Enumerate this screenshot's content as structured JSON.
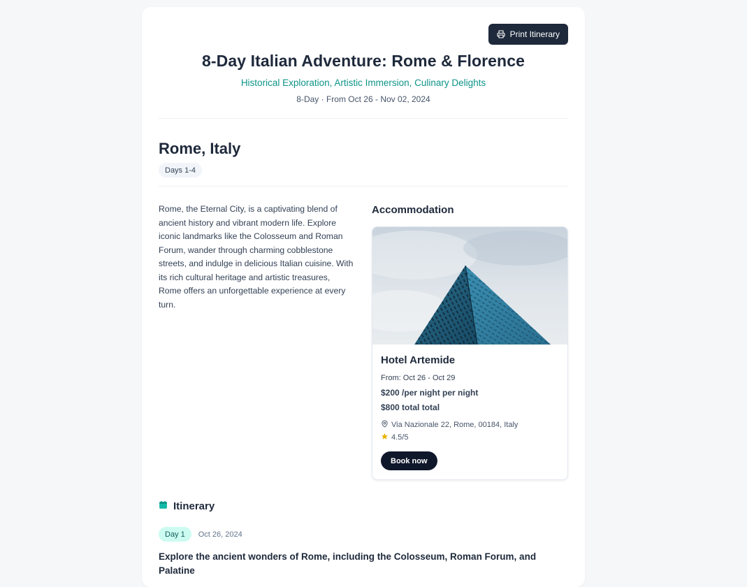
{
  "header": {
    "print_label": "Print Itinerary",
    "title": "8-Day Italian Adventure: Rome & Florence",
    "subtitle": "Historical Exploration, Artistic Immersion, Culinary Delights",
    "dates": "8-Day · From Oct 26 - Nov 02, 2024"
  },
  "destination": {
    "city": "Rome, Italy",
    "days_badge": "Days 1-4",
    "description": "Rome, the Eternal City, is a captivating blend of ancient history and vibrant modern life. Explore iconic landmarks like the Colosseum and Roman Forum, wander through charming cobblestone streets, and indulge in delicious Italian cuisine. With its rich cultural heritage and artistic treasures, Rome offers an unforgettable experience at every turn."
  },
  "accommodation": {
    "heading": "Accommodation",
    "hotel_name": "Hotel Artemide",
    "stay": "From: Oct 26 - Oct 29",
    "nightly_price": "$200 /per night per night",
    "total_price": "$800 total total",
    "address": "Via Nazionale 22, Rome, 00184, Italy",
    "rating": "4.5/5",
    "book_label": "Book now"
  },
  "itinerary": {
    "heading": "Itinerary",
    "days": [
      {
        "badge": "Day 1",
        "date": "Oct 26, 2024",
        "description": "Explore the ancient wonders of Rome, including the Colosseum, Roman Forum, and Palatine"
      }
    ]
  },
  "colors": {
    "accent": "#0d9488",
    "dark": "#1e293b",
    "star": "#eab308"
  },
  "icons": {
    "print": "printer-icon",
    "location": "map-pin-icon",
    "rating": "star-icon",
    "itinerary": "calendar-icon"
  }
}
